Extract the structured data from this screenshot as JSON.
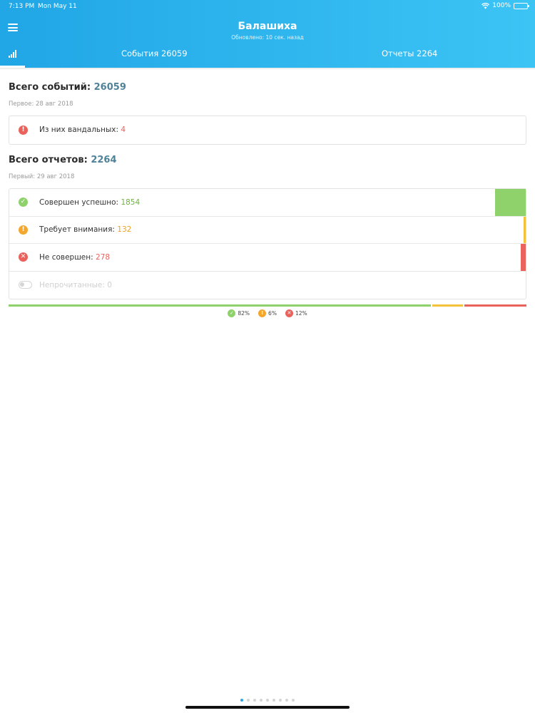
{
  "status_bar": {
    "time": "7:13 PM",
    "date": "Mon May 11",
    "battery": "100%"
  },
  "header": {
    "title": "Балашиха",
    "subtitle": "Обновлено: 10 сек. назад",
    "tabs": {
      "events": "События 26059",
      "reports": "Отчеты 2264"
    }
  },
  "events": {
    "title_label": "Всего событий:",
    "total": "26059",
    "first": "Первое: 28 авг 2018",
    "vandal_label": "Из них вандальных:",
    "vandal_value": "4"
  },
  "reports": {
    "title_label": "Всего отчетов:",
    "total": "2264",
    "first": "Первый: 29 авг 2018",
    "rows": [
      {
        "label": "Совершен успешно:",
        "value": "1854",
        "status": "success"
      },
      {
        "label": "Требует внимания:",
        "value": "132",
        "status": "warning"
      },
      {
        "label": "Не совершен:",
        "value": "278",
        "status": "error"
      },
      {
        "label": "Непрочитанные:",
        "value": "0",
        "status": "unread"
      }
    ]
  },
  "summary": {
    "success_pct": "82%",
    "warning_pct": "6%",
    "error_pct": "12%",
    "success_fraction": 0.82,
    "warning_fraction": 0.06,
    "error_fraction": 0.12
  },
  "colors": {
    "success": "#8fd16a",
    "warning": "#f4c23a",
    "error": "#e9625b",
    "accent": "#2aa7e4"
  },
  "pager": {
    "pages": 9,
    "active": 0
  }
}
